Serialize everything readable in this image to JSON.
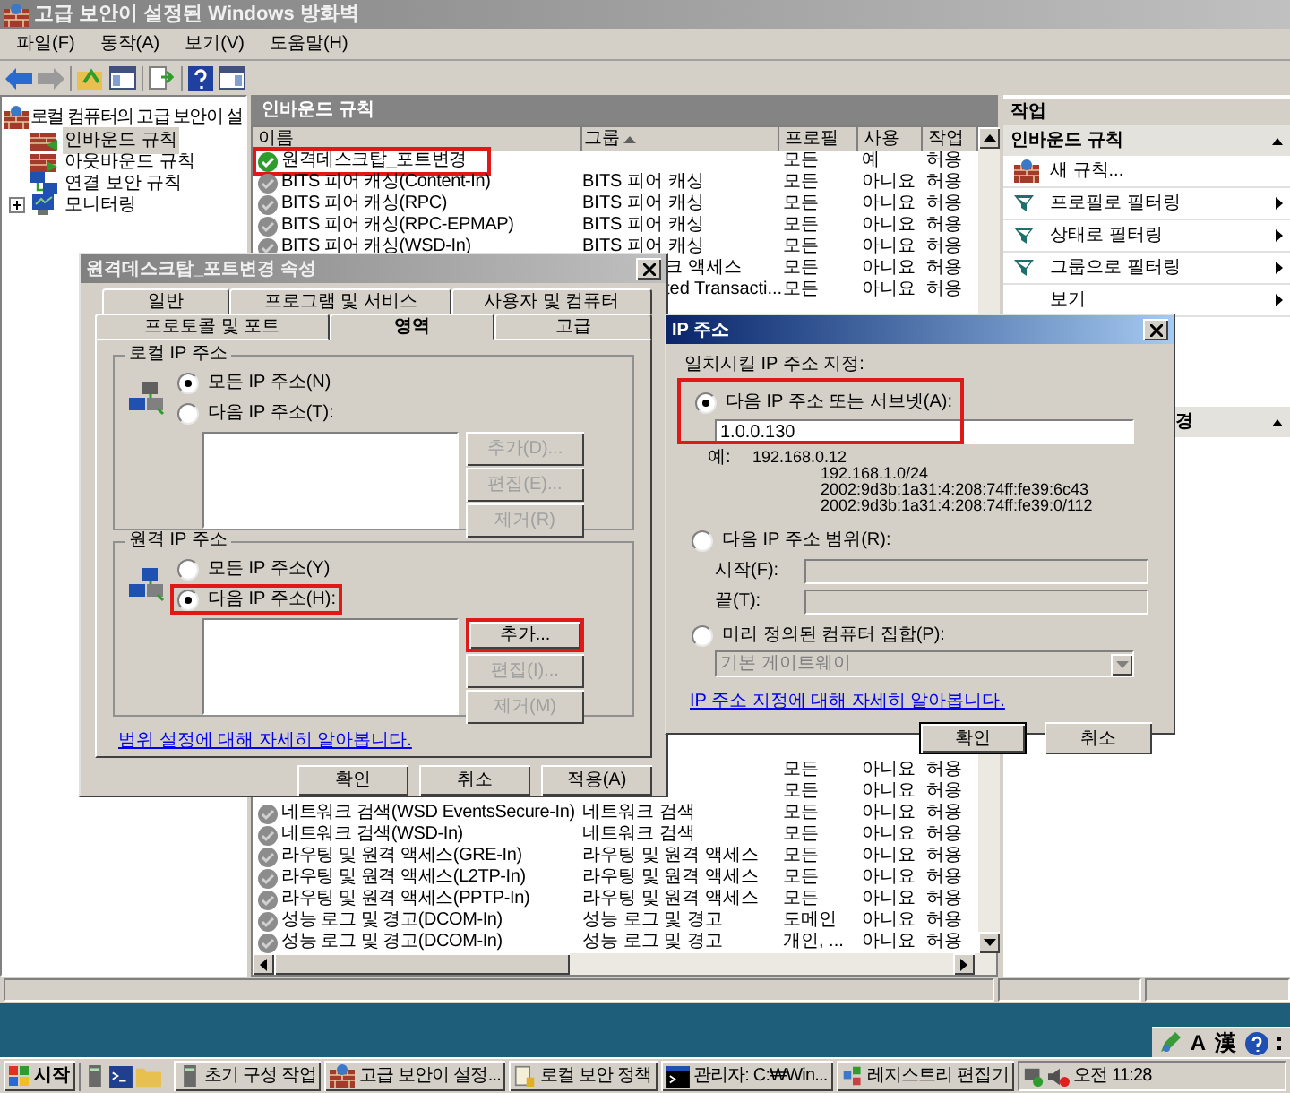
{
  "window": {
    "title": "고급 보안이 설정된 Windows 방화벽"
  },
  "menu": [
    "파일(F)",
    "동작(A)",
    "보기(V)",
    "도움말(H)"
  ],
  "tree": {
    "label": "로컬 컴퓨터의 고급 보안이 설",
    "children": [
      {
        "label": "인바운드 규칙",
        "kind": "inbound",
        "selected": true,
        "expandable": false
      },
      {
        "label": "아웃바운드 규칙",
        "kind": "outbound",
        "selected": false,
        "expandable": false
      },
      {
        "label": "연결 보안 규칙",
        "kind": "connection",
        "selected": false,
        "expandable": false
      },
      {
        "label": "모니터링",
        "kind": "monitor",
        "selected": false,
        "expandable": true
      }
    ]
  },
  "panel": {
    "title": "인바운드 규칙",
    "columns": [
      {
        "label": "이름",
        "sorted": false
      },
      {
        "label": "그룹",
        "sorted": true
      },
      {
        "label": "프로필",
        "sorted": false
      },
      {
        "label": "사용",
        "sorted": false
      },
      {
        "label": "작업",
        "sorted": false
      }
    ],
    "rows_top": [
      {
        "kind": "full",
        "name": "원격데스크탑_포트변경",
        "status_on": true,
        "highlighted": true,
        "profile": "모든",
        "enabled": "예",
        "action": "허용"
      },
      {
        "kind": "full",
        "name": "BITS 피어 캐싱(Content-In)",
        "group": "BITS 피어 캐싱",
        "status_on": false,
        "highlighted": false,
        "profile": "모든",
        "enabled": "아니요",
        "action": "허용"
      },
      {
        "kind": "full",
        "name": "BITS 피어 캐싱(RPC)",
        "group": "BITS 피어 캐싱",
        "status_on": false,
        "highlighted": false,
        "profile": "모든",
        "enabled": "아니요",
        "action": "허용"
      },
      {
        "kind": "full",
        "name": "BITS 피어 캐싱(RPC-EPMAP)",
        "group": "BITS 피어 캐싱",
        "status_on": false,
        "highlighted": false,
        "profile": "모든",
        "enabled": "아니요",
        "action": "허용"
      },
      {
        "kind": "full",
        "name": "BITS 피어 캐싱(WSD-In)",
        "group": "BITS 피어 캐싱",
        "status_on": false,
        "highlighted": false,
        "profile": "모든",
        "enabled": "아니요",
        "action": "허용"
      },
      {
        "kind": "tail",
        "group": "크 액세스",
        "profile": "모든",
        "enabled": "아니요",
        "action": "허용"
      },
      {
        "kind": "tail",
        "group": "ted Transacti...",
        "profile": "모든",
        "enabled": "아니요",
        "action": "허용"
      }
    ],
    "rows_bottom": [
      {
        "kind": "right",
        "profile": "모든",
        "enabled": "아니요",
        "action": "허용"
      },
      {
        "kind": "right",
        "profile": "모든",
        "enabled": "아니요",
        "action": "허용"
      },
      {
        "kind": "full",
        "name": "네트워크 검색(WSD EventsSecure-In)",
        "group": "네트워크 검색",
        "status_on": false,
        "highlighted": false,
        "profile": "모든",
        "enabled": "아니요",
        "action": "허용"
      },
      {
        "kind": "full",
        "name": "네트워크 검색(WSD-In)",
        "group": "네트워크 검색",
        "status_on": false,
        "highlighted": false,
        "profile": "모든",
        "enabled": "아니요",
        "action": "허용"
      },
      {
        "kind": "full",
        "name": "라우팅 및 원격 액세스(GRE-In)",
        "group": "라우팅 및 원격 액세스",
        "status_on": false,
        "highlighted": false,
        "profile": "모든",
        "enabled": "아니요",
        "action": "허용"
      },
      {
        "kind": "full",
        "name": "라우팅 및 원격 액세스(L2TP-In)",
        "group": "라우팅 및 원격 액세스",
        "status_on": false,
        "highlighted": false,
        "profile": "모든",
        "enabled": "아니요",
        "action": "허용"
      },
      {
        "kind": "full",
        "name": "라우팅 및 원격 액세스(PPTP-In)",
        "group": "라우팅 및 원격 액세스",
        "status_on": false,
        "highlighted": false,
        "profile": "모든",
        "enabled": "아니요",
        "action": "허용"
      },
      {
        "kind": "full",
        "name": "성능 로그 및 경고(DCOM-In)",
        "group": "성능 로그 및 경고",
        "status_on": false,
        "highlighted": false,
        "profile": "도메인",
        "enabled": "아니요",
        "action": "허용"
      },
      {
        "kind": "full",
        "name": "성능 로그 및 경고(DCOM-In)",
        "group": "성능 로그 및 경고",
        "status_on": false,
        "highlighted": false,
        "profile": "개인, ...",
        "enabled": "아니요",
        "action": "허용"
      }
    ]
  },
  "actions": {
    "title": "작업",
    "sections": [
      {
        "kind": "full",
        "title": "인바운드 규칙",
        "items": [
          {
            "label": "새 규칙...",
            "kind": "new",
            "submenu": false
          },
          {
            "label": "프로필로 필터링",
            "kind": "filter",
            "submenu": true
          },
          {
            "label": "상태로 필터링",
            "kind": "filter",
            "submenu": true
          },
          {
            "label": "그룹으로 필터링",
            "kind": "filter",
            "submenu": true
          },
          {
            "label": "보기",
            "kind": "plain",
            "submenu": true
          }
        ]
      },
      {
        "kind": "tail",
        "title": "경"
      }
    ]
  },
  "properties_dialog": {
    "title": "원격데스크탑_포트변경 속성",
    "tabs_back": [
      {
        "label": "일반",
        "selected": false
      },
      {
        "label": "프로그램 및 서비스",
        "selected": false
      },
      {
        "label": "사용자 및 컴퓨터",
        "selected": false
      }
    ],
    "tabs_front": [
      {
        "label": "프로토콜 및 포트",
        "selected": false
      },
      {
        "label": "영역",
        "selected": true
      },
      {
        "label": "고급",
        "selected": false
      }
    ],
    "groups": [
      {
        "title": "로컬 IP 주소",
        "options": [
          {
            "label": "모든 IP 주소(N)",
            "selected": true,
            "highlighted": false
          },
          {
            "label": "다음 IP 주소(T):",
            "selected": false,
            "highlighted": false
          }
        ],
        "buttons": [
          {
            "label": "추가(D)...",
            "disabled": true,
            "highlighted": false
          },
          {
            "label": "편집(E)...",
            "disabled": true,
            "highlighted": false
          },
          {
            "label": "제거(R)",
            "disabled": true,
            "highlighted": false
          }
        ]
      },
      {
        "title": "원격 IP 주소",
        "options": [
          {
            "label": "모든 IP 주소(Y)",
            "selected": false,
            "highlighted": false
          },
          {
            "label": "다음 IP 주소(H):",
            "selected": true,
            "highlighted": true
          }
        ],
        "buttons": [
          {
            "label": "추가...",
            "disabled": false,
            "highlighted": true
          },
          {
            "label": "편집(I)...",
            "disabled": true,
            "highlighted": false
          },
          {
            "label": "제거(M)",
            "disabled": true,
            "highlighted": false
          }
        ]
      }
    ],
    "link": "범위 설정에 대해 자세히 알아봅니다.",
    "buttons": [
      "확인",
      "취소",
      "적용(A)"
    ]
  },
  "ip_dialog": {
    "title": "IP 주소",
    "prompt": "일치시킬 IP 주소 지정:",
    "subnet": {
      "label": "다음 IP 주소 또는 서브넷(A):",
      "selected": true,
      "value": "1.0.0.130",
      "highlighted": true
    },
    "examples_label": "예:",
    "examples": [
      "192.168.0.12",
      "192.168.1.0/24",
      "2002:9d3b:1a31:4:208:74ff:fe39:6c43",
      "2002:9d3b:1a31:4:208:74ff:fe39:0/112"
    ],
    "range": {
      "label": "다음 IP 주소 범위(R):",
      "selected": false,
      "start_label": "시작(F):",
      "end_label": "끝(T):"
    },
    "predefined": {
      "label": "미리 정의된 컴퓨터 집합(P):",
      "selected": false,
      "value": "기본 게이트웨이"
    },
    "link": "IP 주소 지정에 대해 자세히 알아봅니다.",
    "buttons": [
      {
        "label": "확인",
        "default": true
      },
      {
        "label": "취소",
        "default": false
      }
    ]
  },
  "language_bar": [
    "A",
    "漢"
  ],
  "taskbar": {
    "start": "시작",
    "tasks": [
      {
        "label": "초기 구성 작업",
        "kind": "server",
        "selected": false
      },
      {
        "label": "고급 보안이 설정...",
        "kind": "firewall",
        "selected": false
      },
      {
        "label": "로컬 보안 정책",
        "kind": "policy",
        "selected": false
      },
      {
        "label": "관리자: C:₩Win...",
        "kind": "console",
        "selected": false
      },
      {
        "label": "레지스트리 편집기",
        "kind": "registry",
        "selected": false
      }
    ],
    "clock": "오전 11:28"
  }
}
